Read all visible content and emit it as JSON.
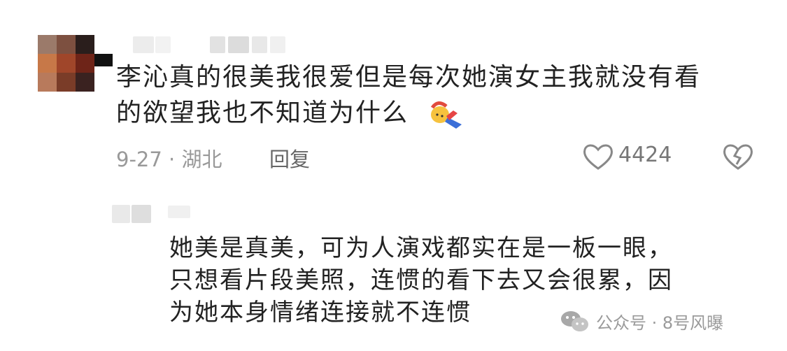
{
  "comment": {
    "text_line1": "李沁真的很美我很爱但是每次她演女主我就没有看",
    "text_line2": "的欲望我也不知道为什么",
    "emoji": "falling-person-emoji",
    "date_location": "9-27 · 湖北",
    "reply_label": "回复",
    "like_count": "4424",
    "like_icon": "heart-outline-icon",
    "dislike_icon": "broken-heart-icon"
  },
  "reply": {
    "text_line1": "她美是真美，可为人演戏都实在是一板一眼，",
    "text_line2": "只想看片段美照，连惯的看下去又会很累，因",
    "text_line3": "为她本身情绪连接就不连惯"
  },
  "watermark": {
    "icon": "wechat-icon",
    "text": "公众号 · 8号风曝"
  }
}
